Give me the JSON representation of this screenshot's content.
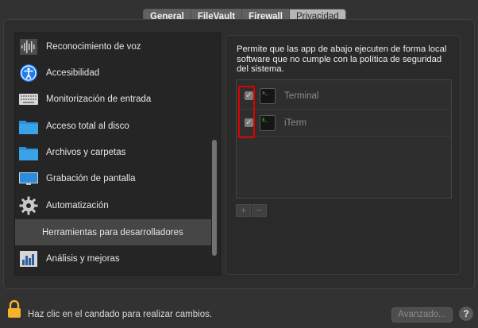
{
  "tabs": [
    {
      "label": "General",
      "active": false
    },
    {
      "label": "FileVault",
      "active": false
    },
    {
      "label": "Firewall",
      "active": false
    },
    {
      "label": "Privacidad",
      "active": true
    }
  ],
  "sidebar": {
    "items": [
      {
        "label": "Reconocimiento de voz",
        "icon": "waveform-icon"
      },
      {
        "label": "Accesibilidad",
        "icon": "accessibility-icon"
      },
      {
        "label": "Monitorización de entrada",
        "icon": "keyboard-icon"
      },
      {
        "label": "Acceso total al disco",
        "icon": "folder-icon"
      },
      {
        "label": "Archivos y carpetas",
        "icon": "folder-icon"
      },
      {
        "label": "Grabación de pantalla",
        "icon": "display-icon"
      },
      {
        "label": "Automatización",
        "icon": "gear-icon"
      },
      {
        "label": "Herramientas para desarrolladores",
        "icon": "",
        "selected": true
      },
      {
        "label": "Análisis y mejoras",
        "icon": "bar-chart-icon"
      }
    ]
  },
  "main": {
    "description": "Permite que las app de abajo ejecuten de forma local software que no cumple con la política de seguridad del sistema.",
    "apps": [
      {
        "name": "Terminal",
        "checked": true,
        "icon": "terminal-icon"
      },
      {
        "name": "iTerm",
        "checked": true,
        "icon": "iterm-icon"
      }
    ],
    "add_label": "+",
    "remove_label": "−"
  },
  "footer": {
    "lock_text": "Haz clic en el candado para realizar cambios.",
    "advanced_label": "Avanzado...",
    "help_label": "?"
  },
  "colors": {
    "highlight": "#e00000",
    "folder": "#3aa3e8",
    "accessibility": "#1e7cf0"
  }
}
